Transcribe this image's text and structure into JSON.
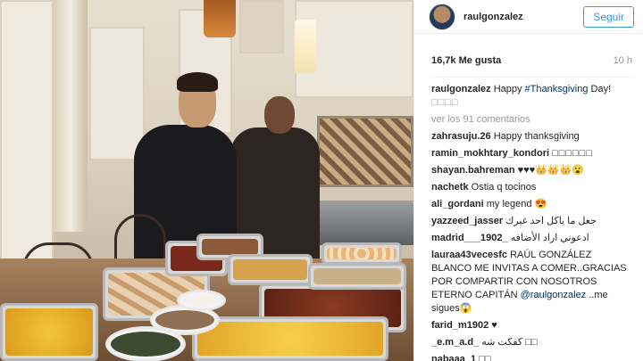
{
  "post": {
    "username": "raulgonzalez",
    "follow_label": "Seguir",
    "likes": "16,7k Me gusta",
    "time": "10 h",
    "more_comments": "ver los 91 comentarios"
  },
  "caption": {
    "user": "raulgonzalez",
    "text_before": "Happy ",
    "hashtag": "#Thanksgiving",
    "text_after": " Day!",
    "extra": "□□□□"
  },
  "comments": [
    {
      "user": "zahrasuju.26",
      "text": "Happy thanksgiving"
    },
    {
      "user": "ramin_mokhtary_kondori",
      "text": "□□□□□□"
    },
    {
      "user": "shayan.bahreman",
      "text": "♥♥♥👑👑👑😮"
    },
    {
      "user": "nachetk",
      "text": "Ostia q tocinos"
    },
    {
      "user": "ali_gordani",
      "text": "my legend 😍"
    },
    {
      "user": "yazzeed_jasser",
      "text": "جعل ما ياكل احد غيرك"
    },
    {
      "user": "madrid___1902_",
      "text": "ادعوني اراد الأضافه"
    },
    {
      "user": "lauraa43vecesfc",
      "text": "RAÚL GONZÁLEZ BLANCO ME INVITAS A COMER..GRACIAS POR COMPARTIR CON NOSOTROS ETERNO CAPITÁN",
      "mention": "@raulgonzalez",
      "after": " ..me sigues😱"
    },
    {
      "user": "farid_m1902",
      "text": "♥"
    },
    {
      "user": "_e.m_a.d_",
      "text": "کفکت شه □□"
    },
    {
      "user": "nabaaa_1",
      "text": "□□"
    }
  ],
  "icons": {
    "avatar": "user-avatar"
  }
}
